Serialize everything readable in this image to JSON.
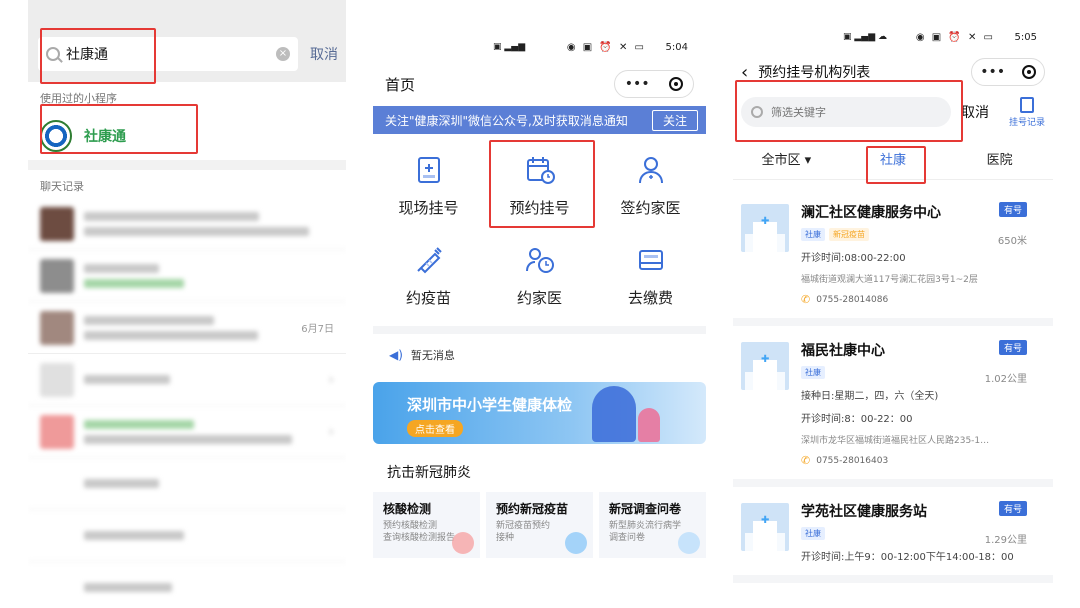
{
  "panel1": {
    "search": {
      "value": "社康通",
      "cancel": "取消",
      "clear_icon": "×"
    },
    "used_section_title": "使用过的小程序",
    "mini_program": {
      "name": "社康通"
    },
    "chat_section_title": "聊天记录",
    "chat_dates": [
      "6月7日"
    ]
  },
  "panel2": {
    "status_time": "5:04",
    "nav_title": "首页",
    "capsule_more": "•••",
    "banner_text": "关注\"健康深圳\"微信公众号,及时获取消息通知",
    "banner_button": "关注",
    "tiles": [
      {
        "label": "现场挂号",
        "icon": "hospital-card-icon"
      },
      {
        "label": "预约挂号",
        "icon": "calendar-clock-icon"
      },
      {
        "label": "签约家医",
        "icon": "doctor-icon"
      },
      {
        "label": "约疫苗",
        "icon": "syringe-icon"
      },
      {
        "label": "约家医",
        "icon": "family-doctor-icon"
      },
      {
        "label": "去缴费",
        "icon": "wallet-icon"
      }
    ],
    "notice": "暂无消息",
    "hero": {
      "title": "深圳市中小学生健康体检",
      "button": "点击查看"
    },
    "section_title": "抗击新冠肺炎",
    "cards": [
      {
        "title": "核酸检测",
        "line1": "预约核酸检测",
        "line2": "查询核酸检测报告"
      },
      {
        "title": "预约新冠疫苗",
        "line1": "新冠疫苗预约",
        "line2": "接种"
      },
      {
        "title": "新冠调查问卷",
        "line1": "新型肺炎流行病学",
        "line2": "调查问卷"
      }
    ]
  },
  "panel3": {
    "status_time": "5:05",
    "nav_title": "预约挂号机构列表",
    "capsule_more": "•••",
    "search_placeholder": "筛选关键字",
    "cancel": "取消",
    "record": "挂号记录",
    "filters": [
      "全市区",
      "社康",
      "医院"
    ],
    "institutions": [
      {
        "name": "澜汇社区健康服务中心",
        "badge": "有号",
        "tags": [
          "社康",
          "新冠疫苗"
        ],
        "distance": "650米",
        "hours": "开诊时间:08:00-22:00",
        "address": "福城街道观澜大道117号澜汇花园3号1~2层",
        "phone": "0755-28014086"
      },
      {
        "name": "福民社康中心",
        "badge": "有号",
        "tags": [
          "社康"
        ],
        "distance": "1.02公里",
        "days": "接种日:星期二，四，六（全天)",
        "hours": "开诊时间:8：00-22：00",
        "address": "深圳市龙华区福城街道福民社区人民路235-1…",
        "phone": "0755-28016403"
      },
      {
        "name": "学苑社区健康服务站",
        "badge": "有号",
        "tags": [
          "社康"
        ],
        "distance": "1.29公里",
        "hours": "开诊时间:上午9：00-12:00下午14:00-18：00"
      }
    ]
  }
}
